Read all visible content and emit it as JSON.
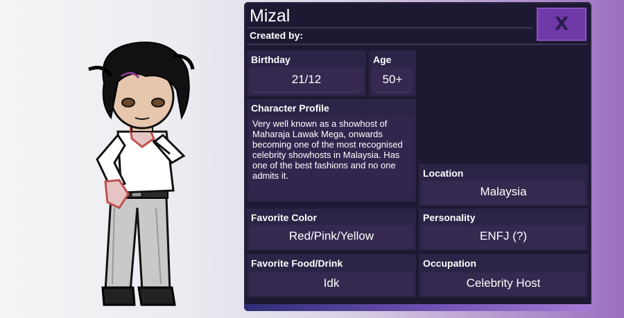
{
  "character": {
    "name": "Mizal",
    "created_by_label": "Created by:"
  },
  "close_button": {
    "icon": "close-x-icon",
    "label": "X"
  },
  "fields": {
    "birthday": {
      "label": "Birthday",
      "value": "21/12"
    },
    "age": {
      "label": "Age",
      "value": "50+"
    },
    "profile": {
      "label": "Character Profile",
      "text": "Very well known as a showhost of Maharaja Lawak Mega, onwards becoming one of the most recognised celebrity showhosts in Malaysia. Has one of the best fashions and no one admits it."
    },
    "location": {
      "label": "Location",
      "value": "Malaysia"
    },
    "favorite_color": {
      "label": "Favorite Color",
      "value": "Red/Pink/Yellow"
    },
    "personality": {
      "label": "Personality",
      "value": "ENFJ (?)"
    },
    "favorite_food": {
      "label": "Favorite Food/Drink",
      "value": "Idk"
    },
    "occupation": {
      "label": "Occupation",
      "value": "Celebrity Host"
    }
  },
  "colors": {
    "panel_bg": "#1e1932",
    "box_bg": "#2b2446",
    "value_bg": "#35294f",
    "close_button": "#6f3aa8",
    "accent_bottom": "#a77bd6"
  }
}
